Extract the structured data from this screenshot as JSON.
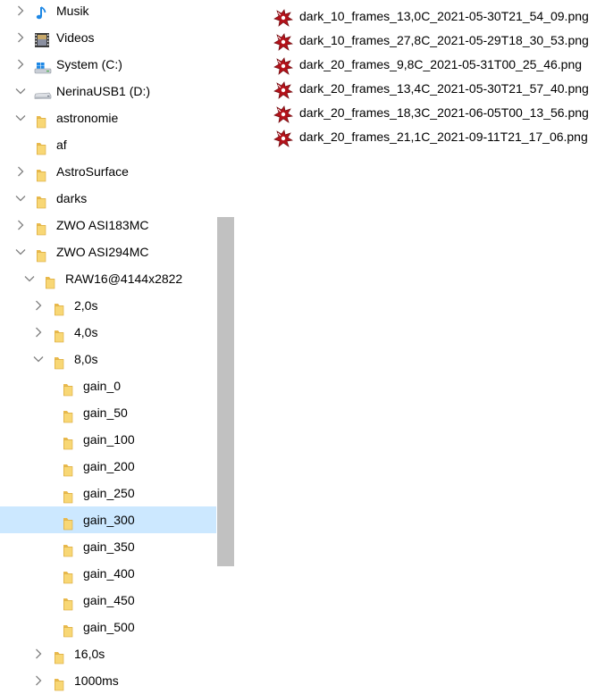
{
  "nav_tree": [
    {
      "label": "Musik",
      "icon": "music-note-icon",
      "level": 0,
      "chevron": "right"
    },
    {
      "label": "Videos",
      "icon": "video-film-icon",
      "level": 0,
      "chevron": "right"
    },
    {
      "label": "System (C:)",
      "icon": "system-drive-icon",
      "level": 0,
      "chevron": "right"
    },
    {
      "label": "NerinaUSB1 (D:)",
      "icon": "usb-drive-icon",
      "level": 0,
      "chevron": "down"
    },
    {
      "label": "astronomie",
      "icon": "folder-icon",
      "level": 1,
      "chevron": "down"
    },
    {
      "label": "af",
      "icon": "folder-icon",
      "level": 2,
      "chevron": "none"
    },
    {
      "label": "AstroSurface",
      "icon": "folder-icon",
      "level": 2,
      "chevron": "right"
    },
    {
      "label": "darks",
      "icon": "folder-icon",
      "level": 2,
      "chevron": "down"
    },
    {
      "label": "ZWO ASI183MC",
      "icon": "folder-icon",
      "level": 3,
      "chevron": "right"
    },
    {
      "label": "ZWO ASI294MC",
      "icon": "folder-icon",
      "level": 3,
      "chevron": "down"
    },
    {
      "label": "RAW16@4144x2822",
      "icon": "folder-icon",
      "level": 4,
      "chevron": "down"
    },
    {
      "label": "2,0s",
      "icon": "folder-icon",
      "level": 5,
      "chevron": "right"
    },
    {
      "label": "4,0s",
      "icon": "folder-icon",
      "level": 5,
      "chevron": "right"
    },
    {
      "label": "8,0s",
      "icon": "folder-icon",
      "level": 5,
      "chevron": "down"
    },
    {
      "label": "gain_0",
      "icon": "folder-icon",
      "level": 6,
      "chevron": "none"
    },
    {
      "label": "gain_50",
      "icon": "folder-icon",
      "level": 6,
      "chevron": "none"
    },
    {
      "label": "gain_100",
      "icon": "folder-icon",
      "level": 6,
      "chevron": "none"
    },
    {
      "label": "gain_200",
      "icon": "folder-icon",
      "level": 6,
      "chevron": "none"
    },
    {
      "label": "gain_250",
      "icon": "folder-icon",
      "level": 6,
      "chevron": "none"
    },
    {
      "label": "gain_300",
      "icon": "folder-icon",
      "level": 6,
      "chevron": "none",
      "selected": true
    },
    {
      "label": "gain_350",
      "icon": "folder-icon",
      "level": 6,
      "chevron": "none"
    },
    {
      "label": "gain_400",
      "icon": "folder-icon",
      "level": 6,
      "chevron": "none"
    },
    {
      "label": "gain_450",
      "icon": "folder-icon",
      "level": 6,
      "chevron": "none"
    },
    {
      "label": "gain_500",
      "icon": "folder-icon",
      "level": 6,
      "chevron": "none"
    },
    {
      "label": "16,0s",
      "icon": "folder-icon",
      "level": 5,
      "chevron": "right"
    },
    {
      "label": "1000ms",
      "icon": "folder-icon",
      "level": 5,
      "chevron": "right"
    }
  ],
  "files": [
    {
      "name": "dark_10_frames_13,0C_2021-05-30T21_54_09.png",
      "icon": "png-image-icon"
    },
    {
      "name": "dark_10_frames_27,8C_2021-05-29T18_30_53.png",
      "icon": "png-image-icon"
    },
    {
      "name": "dark_20_frames_9,8C_2021-05-31T00_25_46.png",
      "icon": "png-image-icon"
    },
    {
      "name": "dark_20_frames_13,4C_2021-05-30T21_57_40.png",
      "icon": "png-image-icon"
    },
    {
      "name": "dark_20_frames_18,3C_2021-06-05T00_13_56.png",
      "icon": "png-image-icon"
    },
    {
      "name": "dark_20_frames_21,1C_2021-09-11T21_17_06.png",
      "icon": "png-image-icon"
    }
  ],
  "colors": {
    "selection": "#cce8ff",
    "folder": "#f8d775",
    "scroll_thumb": "#c1c1c1",
    "chevron": "#808080"
  }
}
